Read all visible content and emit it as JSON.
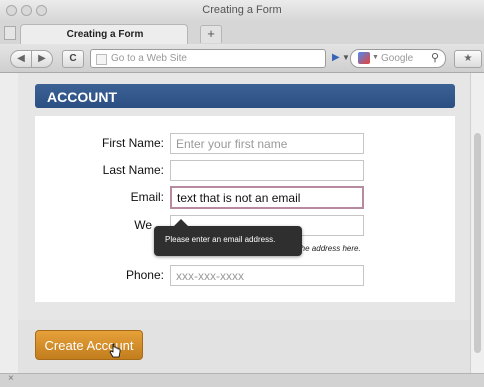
{
  "window": {
    "title": "Creating a Form"
  },
  "tabs": [
    {
      "label": "Creating a Form"
    }
  ],
  "new_tab_label": "+",
  "toolbar": {
    "address_placeholder": "Go to a Web Site",
    "search_label": "Google"
  },
  "form": {
    "header": "ACCOUNT",
    "fields": {
      "first_name": {
        "label": "First Name:",
        "placeholder": "Enter your first name",
        "value": ""
      },
      "last_name": {
        "label": "Last Name:",
        "placeholder": "",
        "value": ""
      },
      "email": {
        "label": "Email:",
        "placeholder": "",
        "value": "text that is not an email"
      },
      "website": {
        "label": "We",
        "placeholder": "",
        "value": ""
      },
      "phone": {
        "label": "Phone:",
        "placeholder": "xxx-xxx-xxxx",
        "value": ""
      }
    },
    "website_hint": "t the address here.",
    "validation_message": "Please enter an email address.",
    "submit_label": "Create Account"
  },
  "colors": {
    "header_bg": "#2f5387",
    "button_bg": "#d38e2a",
    "invalid_border": "#b88a9f",
    "tooltip_bg": "#2f2f2f"
  }
}
